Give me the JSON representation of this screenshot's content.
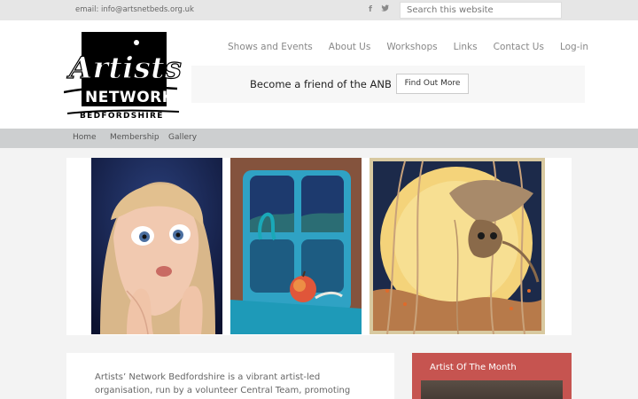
{
  "topbar": {
    "email": "email: info@artsnetbeds.org.uk",
    "facebook_glyph": "f",
    "twitter_glyph": "🐦",
    "search_placeholder": "Search this website"
  },
  "logo": {
    "line1": "Artists'",
    "line2": "NETWORK",
    "line3": "BEDFORDSHIRE"
  },
  "main_nav": [
    "Shows and Events",
    "About Us",
    "Workshops",
    "Links",
    "Contact Us",
    "Log-in"
  ],
  "promo": {
    "text": "Become a friend of the ANB",
    "button": "Find Out More"
  },
  "sub_nav": [
    "Home",
    "Membership",
    "Gallery"
  ],
  "gallery": {
    "items": [
      "girl-portrait-painting",
      "window-apple-painting",
      "owl-moon-painting"
    ]
  },
  "intro": {
    "text": "Artists’ Network Bedfordshire is a vibrant artist-led organisation, run by a volunteer Central Team, promoting original works of art"
  },
  "sidebar": {
    "artist_of_month_title": "Artist Of The Month"
  },
  "colors": {
    "topbar_bg": "#e6e6e6",
    "subnav_bg": "#cdcfd0",
    "sidebar_accent": "#c65450"
  }
}
